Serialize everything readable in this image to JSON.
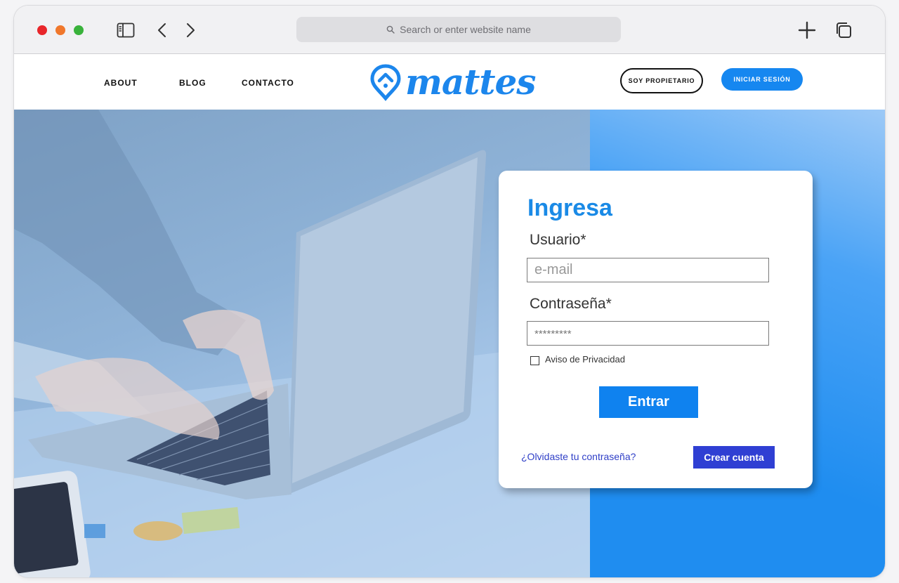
{
  "browser": {
    "url_placeholder": "Search or enter website name"
  },
  "nav": {
    "about": "ABOUT",
    "blog": "BLOG",
    "contacto": "CONTACTO"
  },
  "logo": {
    "text": "mattes",
    "color": "#1c86ec"
  },
  "header_buttons": {
    "owner": "SOY PROPIETARIO",
    "login": "INICIAR SESIÓN"
  },
  "login_form": {
    "title": "Ingresa",
    "user_label": "Usuario*",
    "user_placeholder": "e-mail",
    "password_label": "Contraseña*",
    "password_placeholder": "*********",
    "privacy_label": "Aviso de Privacidad",
    "submit": "Entrar",
    "forgot": "¿Olvidaste tu contraseña?",
    "create": "Crear cuenta"
  },
  "colors": {
    "accent": "#1687f0",
    "create_button": "#2f3fd3"
  }
}
